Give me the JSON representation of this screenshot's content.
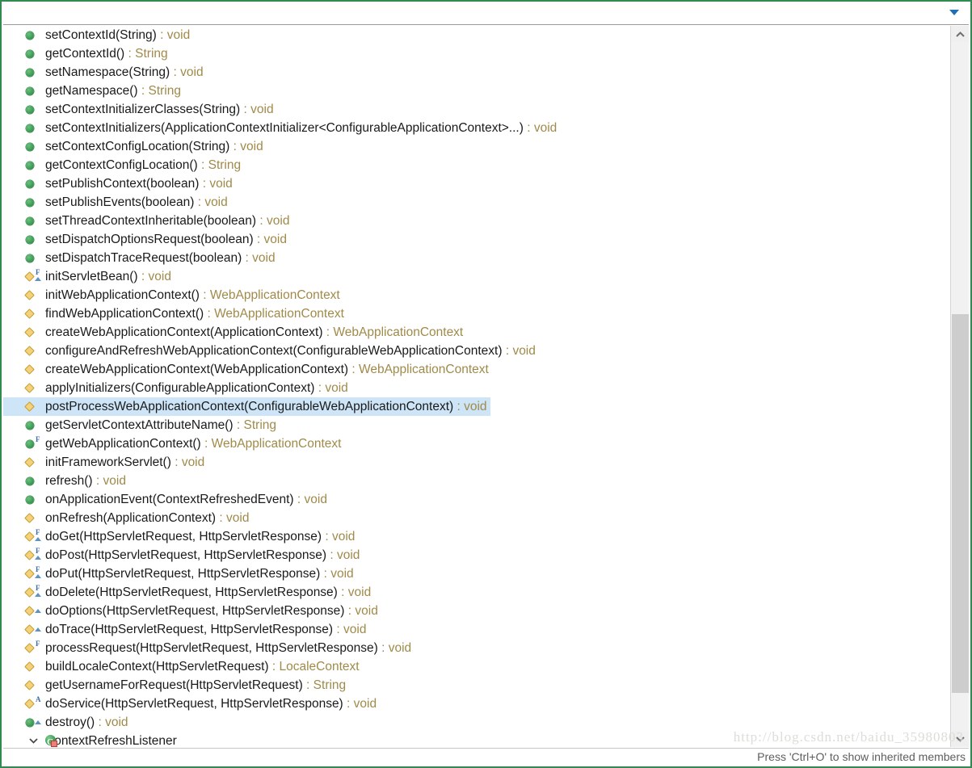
{
  "window": {
    "border_color": "#2f8b4f",
    "background": "#ffffff"
  },
  "toolbar": {
    "menu_arrow_label": "View Menu"
  },
  "colors": {
    "public_icon": "#3f9f57",
    "protected_icon": "#f3d27a",
    "return_type_text": "#a08a4a",
    "member_text": "#1a1a1a",
    "selection_background": "#cde5f7",
    "scrollbar_thumb": "#cdcdcd",
    "class_icon_green": "#3d9e55",
    "private_badge_red": "#f07c7c"
  },
  "statusbar": {
    "text": "Press 'Ctrl+O' to show inherited members"
  },
  "watermark": {
    "text": "http://blog.csdn.net/baidu_35980803"
  },
  "scrollbar": {
    "up_arrow": "scroll-up-icon",
    "down_arrow": "scroll-down-icon",
    "thumb_top_pct": 39.5,
    "thumb_height_pct": 55.0
  },
  "outline": {
    "rows": [
      {
        "visibility": "public",
        "badge": "",
        "override": false,
        "name": "setContextId(String)",
        "return": "void",
        "selected": false
      },
      {
        "visibility": "public",
        "badge": "",
        "override": false,
        "name": "getContextId()",
        "return": "String",
        "selected": false
      },
      {
        "visibility": "public",
        "badge": "",
        "override": false,
        "name": "setNamespace(String)",
        "return": "void",
        "selected": false
      },
      {
        "visibility": "public",
        "badge": "",
        "override": false,
        "name": "getNamespace()",
        "return": "String",
        "selected": false
      },
      {
        "visibility": "public",
        "badge": "",
        "override": false,
        "name": "setContextInitializerClasses(String)",
        "return": "void",
        "selected": false
      },
      {
        "visibility": "public",
        "badge": "",
        "override": false,
        "name": "setContextInitializers(ApplicationContextInitializer<ConfigurableApplicationContext>...)",
        "return": "void",
        "selected": false
      },
      {
        "visibility": "public",
        "badge": "",
        "override": false,
        "name": "setContextConfigLocation(String)",
        "return": "void",
        "selected": false
      },
      {
        "visibility": "public",
        "badge": "",
        "override": false,
        "name": "getContextConfigLocation()",
        "return": "String",
        "selected": false
      },
      {
        "visibility": "public",
        "badge": "",
        "override": false,
        "name": "setPublishContext(boolean)",
        "return": "void",
        "selected": false
      },
      {
        "visibility": "public",
        "badge": "",
        "override": false,
        "name": "setPublishEvents(boolean)",
        "return": "void",
        "selected": false
      },
      {
        "visibility": "public",
        "badge": "",
        "override": false,
        "name": "setThreadContextInheritable(boolean)",
        "return": "void",
        "selected": false
      },
      {
        "visibility": "public",
        "badge": "",
        "override": false,
        "name": "setDispatchOptionsRequest(boolean)",
        "return": "void",
        "selected": false
      },
      {
        "visibility": "public",
        "badge": "",
        "override": false,
        "name": "setDispatchTraceRequest(boolean)",
        "return": "void",
        "selected": false
      },
      {
        "visibility": "protected",
        "badge": "F",
        "override": true,
        "name": "initServletBean()",
        "return": "void",
        "selected": false
      },
      {
        "visibility": "protected",
        "badge": "",
        "override": false,
        "name": "initWebApplicationContext()",
        "return": "WebApplicationContext",
        "selected": false
      },
      {
        "visibility": "protected",
        "badge": "",
        "override": false,
        "name": "findWebApplicationContext()",
        "return": "WebApplicationContext",
        "selected": false
      },
      {
        "visibility": "protected",
        "badge": "",
        "override": false,
        "name": "createWebApplicationContext(ApplicationContext)",
        "return": "WebApplicationContext",
        "selected": false
      },
      {
        "visibility": "protected",
        "badge": "",
        "override": false,
        "name": "configureAndRefreshWebApplicationContext(ConfigurableWebApplicationContext)",
        "return": "void",
        "selected": false
      },
      {
        "visibility": "protected",
        "badge": "",
        "override": false,
        "name": "createWebApplicationContext(WebApplicationContext)",
        "return": "WebApplicationContext",
        "selected": false
      },
      {
        "visibility": "protected",
        "badge": "",
        "override": false,
        "name": "applyInitializers(ConfigurableApplicationContext)",
        "return": "void",
        "selected": false
      },
      {
        "visibility": "protected",
        "badge": "",
        "override": false,
        "name": "postProcessWebApplicationContext(ConfigurableWebApplicationContext)",
        "return": "void",
        "selected": true
      },
      {
        "visibility": "public",
        "badge": "",
        "override": false,
        "name": "getServletContextAttributeName()",
        "return": "String",
        "selected": false
      },
      {
        "visibility": "public",
        "badge": "F",
        "override": false,
        "name": "getWebApplicationContext()",
        "return": "WebApplicationContext",
        "selected": false
      },
      {
        "visibility": "protected",
        "badge": "",
        "override": false,
        "name": "initFrameworkServlet()",
        "return": "void",
        "selected": false
      },
      {
        "visibility": "public",
        "badge": "",
        "override": false,
        "name": "refresh()",
        "return": "void",
        "selected": false
      },
      {
        "visibility": "public",
        "badge": "",
        "override": false,
        "name": "onApplicationEvent(ContextRefreshedEvent)",
        "return": "void",
        "selected": false
      },
      {
        "visibility": "protected",
        "badge": "",
        "override": false,
        "name": "onRefresh(ApplicationContext)",
        "return": "void",
        "selected": false
      },
      {
        "visibility": "protected",
        "badge": "F",
        "override": true,
        "name": "doGet(HttpServletRequest, HttpServletResponse)",
        "return": "void",
        "selected": false
      },
      {
        "visibility": "protected",
        "badge": "F",
        "override": true,
        "name": "doPost(HttpServletRequest, HttpServletResponse)",
        "return": "void",
        "selected": false
      },
      {
        "visibility": "protected",
        "badge": "F",
        "override": true,
        "name": "doPut(HttpServletRequest, HttpServletResponse)",
        "return": "void",
        "selected": false
      },
      {
        "visibility": "protected",
        "badge": "F",
        "override": true,
        "name": "doDelete(HttpServletRequest, HttpServletResponse)",
        "return": "void",
        "selected": false
      },
      {
        "visibility": "protected",
        "badge": "",
        "override": true,
        "name": "doOptions(HttpServletRequest, HttpServletResponse)",
        "return": "void",
        "selected": false
      },
      {
        "visibility": "protected",
        "badge": "",
        "override": true,
        "name": "doTrace(HttpServletRequest, HttpServletResponse)",
        "return": "void",
        "selected": false
      },
      {
        "visibility": "protected",
        "badge": "F",
        "override": false,
        "name": "processRequest(HttpServletRequest, HttpServletResponse)",
        "return": "void",
        "selected": false
      },
      {
        "visibility": "protected",
        "badge": "",
        "override": false,
        "name": "buildLocaleContext(HttpServletRequest)",
        "return": "LocaleContext",
        "selected": false
      },
      {
        "visibility": "protected",
        "badge": "",
        "override": false,
        "name": "getUsernameForRequest(HttpServletRequest)",
        "return": "String",
        "selected": false
      },
      {
        "visibility": "protected",
        "badge": "A",
        "override": false,
        "name": "doService(HttpServletRequest, HttpServletResponse)",
        "return": "void",
        "selected": false
      },
      {
        "visibility": "public",
        "badge": "",
        "override": true,
        "name": "destroy()",
        "return": "void",
        "selected": false
      }
    ],
    "class_row": {
      "name": "ContextRefreshListener",
      "expanded": true
    }
  }
}
